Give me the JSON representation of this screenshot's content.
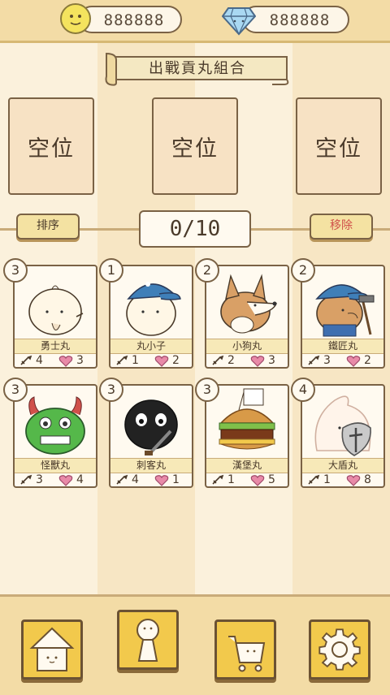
{
  "topbar": {
    "coins": "888888",
    "gems": "888888"
  },
  "banner": {
    "title": "出戰貢丸組合"
  },
  "slots": [
    "空位",
    "空位",
    "空位"
  ],
  "controls": {
    "sort_label": "排序",
    "count": "0/10",
    "remove_label": "移除"
  },
  "cards": [
    {
      "level": "3",
      "name": "勇士丸",
      "attack": "4",
      "hp": "3",
      "art": "warrior"
    },
    {
      "level": "1",
      "name": "丸小子",
      "attack": "1",
      "hp": "2",
      "art": "kid"
    },
    {
      "level": "2",
      "name": "小狗丸",
      "attack": "2",
      "hp": "3",
      "art": "dog"
    },
    {
      "level": "2",
      "name": "鐵匠丸",
      "attack": "3",
      "hp": "2",
      "art": "smith"
    },
    {
      "level": "3",
      "name": "怪獸丸",
      "attack": "3",
      "hp": "4",
      "art": "monster"
    },
    {
      "level": "3",
      "name": "刺客丸",
      "attack": "4",
      "hp": "1",
      "art": "assassin"
    },
    {
      "level": "3",
      "name": "漢堡丸",
      "attack": "1",
      "hp": "5",
      "art": "burger"
    },
    {
      "level": "4",
      "name": "大盾丸",
      "attack": "1",
      "hp": "8",
      "art": "shield"
    }
  ],
  "nav": [
    "home-icon",
    "character-icon",
    "shop-cart-icon",
    "settings-gear-icon"
  ],
  "colors": {
    "accent": "#f2c94c",
    "border": "#7a6245",
    "heart": "#e88aa8"
  }
}
